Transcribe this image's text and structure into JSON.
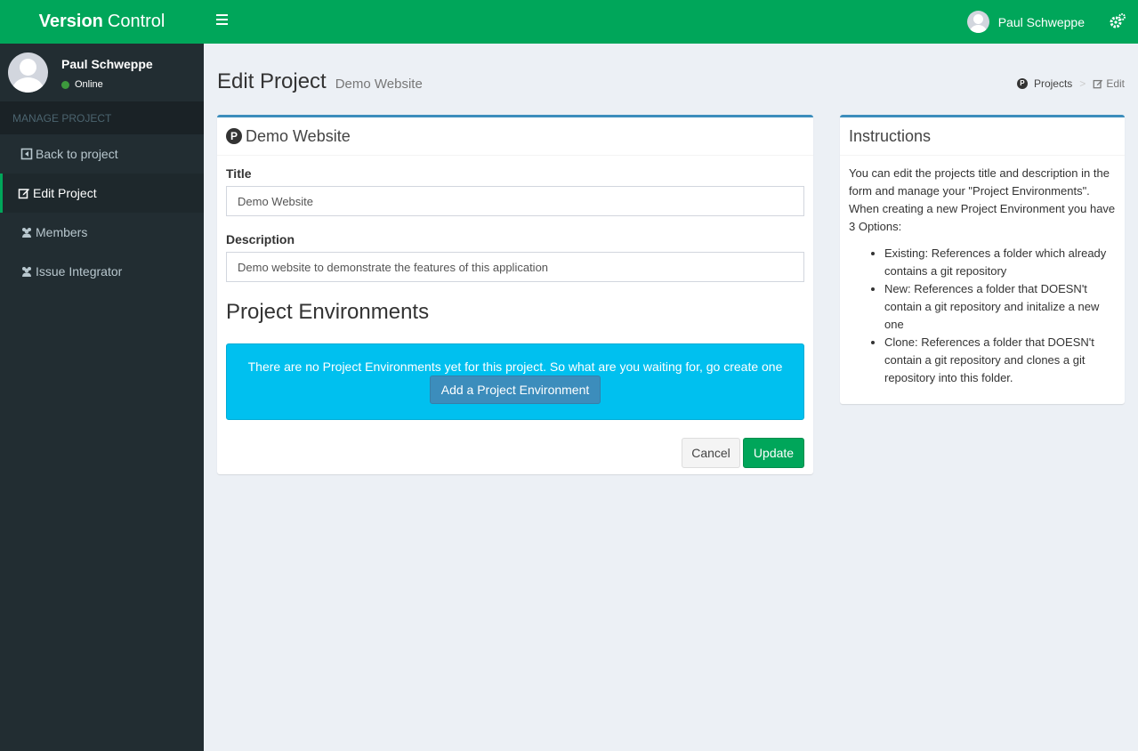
{
  "header": {
    "logo_bold": "Version",
    "logo_rest": "Control",
    "user_name": "Paul Schweppe"
  },
  "sidebar": {
    "user_name": "Paul Schweppe",
    "status": "Online",
    "menu_header": "MANAGE PROJECT",
    "items": [
      {
        "label": "Back to project",
        "icon": "arrow-left-square-icon"
      },
      {
        "label": "Edit Project",
        "icon": "edit-icon"
      },
      {
        "label": "Members",
        "icon": "users-icon"
      },
      {
        "label": "Issue Integrator",
        "icon": "users-icon"
      }
    ]
  },
  "page": {
    "title": "Edit Project",
    "subtitle": "Demo Website",
    "breadcrumb": {
      "projects": "Projects",
      "current": "Edit"
    }
  },
  "form": {
    "box_title": "Demo Website",
    "title_label": "Title",
    "title_value": "Demo Website",
    "description_label": "Description",
    "description_value": "Demo website to demonstrate the features of this application",
    "env_heading": "Project Environments",
    "env_empty_text": "There are no Project Environments yet for this project. So what are you waiting for, go create one",
    "add_env_label": "Add a Project Environment",
    "cancel_label": "Cancel",
    "update_label": "Update"
  },
  "instructions": {
    "title": "Instructions",
    "intro": "You can edit the projects title and description in the form and manage your \"Project Environments\". When creating a new Project Environment you have 3 Options:",
    "options": [
      "Existing: References a folder which already contains a git repository",
      "New: References a folder that DOESN't contain a git repository and initalize a new one",
      "Clone: References a folder that DOESN't contain a git repository and clones a git repository into this folder."
    ]
  },
  "colors": {
    "brand_green": "#00a65a",
    "sidebar_dark": "#222d32",
    "box_border_blue": "#3c8dbc",
    "callout_info": "#00c0ef"
  }
}
